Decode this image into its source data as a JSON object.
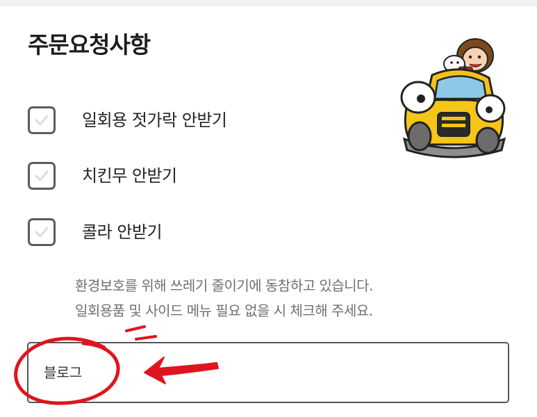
{
  "section": {
    "title": "주문요청사항"
  },
  "options": [
    {
      "label": "일회용 젓가락 안받기",
      "checked": false
    },
    {
      "label": "치킨무 안받기",
      "checked": false
    },
    {
      "label": "콜라 안받기",
      "checked": false
    }
  ],
  "notice": {
    "line1": "환경보호를 위해 쓰레기 줄이기에 동참하고 있습니다.",
    "line2": "일회용품 및 사이드 메뉴 필요 없을 시 체크해 주세요."
  },
  "request": {
    "value": "블로그"
  },
  "colors": {
    "annotation": "#e0141e",
    "checkbox_border": "#5b5b5b",
    "notice_text": "#6f6f6f"
  },
  "icons": [
    "checkmark-icon",
    "taxi-mascot-icon",
    "red-circle-annotation",
    "red-arrow-annotation"
  ]
}
